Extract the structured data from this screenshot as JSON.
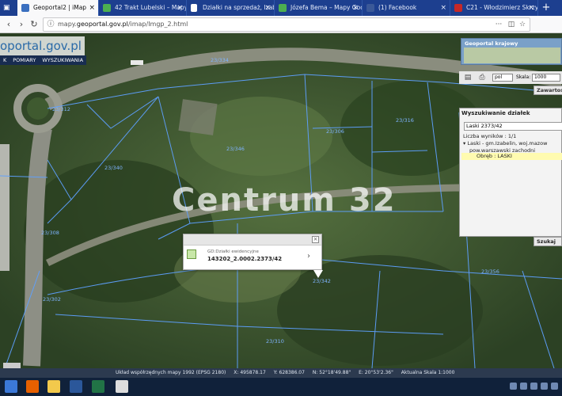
{
  "browser": {
    "tabs": [
      {
        "title": "Geoportal2 | iMap",
        "active": true,
        "icon_color": "#3a6fbf"
      },
      {
        "title": "42 Trakt Lubelski – Mapy Go",
        "active": false,
        "icon_color": "#4caf50"
      },
      {
        "title": "Działki na sprzedaż, Izabelin",
        "active": false,
        "icon_color": "#ffffff"
      },
      {
        "title": "Józefa Bema – Mapy Goo",
        "active": false,
        "icon_color": "#4caf50"
      },
      {
        "title": "(1) Facebook",
        "active": false,
        "icon_color": "#3b5998"
      },
      {
        "title": "C21 - Włodzimierz Skrzy",
        "active": false,
        "icon_color": "#c62828"
      }
    ],
    "close_glyph": "×",
    "new_tab_glyph": "+",
    "url_prefix": "mapy.",
    "url_domain": "geoportal.gov.pl",
    "url_path": "/imap/Imgp_2.html"
  },
  "app": {
    "logo_text": "oportal",
    "logo_domain": ".gov.pl",
    "menu": [
      "K",
      "POMIARY",
      "WYSZUKIWANIA"
    ]
  },
  "map": {
    "watermark": "Centrum 32",
    "parcel_labels": [
      "23/334",
      "23/346",
      "23/306",
      "23/316",
      "23/340",
      "23/312",
      "23/342",
      "23/356",
      "23/308",
      "23/302",
      "23/310"
    ]
  },
  "panel": {
    "geoportal_krajowy": "Geoportal krajowy",
    "lang": "pol",
    "skala_label": "Skala:",
    "skala_value": "1000",
    "zawartosc": "Zawartoś",
    "search_title": "Wyszukiwanie działek",
    "search_value": "Laski 2373/42",
    "results_count": "Liczba wyników : 1/1",
    "result_line1": "Laski - gm.Izabelin, woj.mazow",
    "result_line2": "pow.warszawski zachodni",
    "result_obreb": "Obręb : LASKI",
    "search_button": "Szukaj"
  },
  "popup": {
    "layer": "GD:Działki ewidencyjne",
    "parcel": "143202_2.0002.2373/42",
    "close_glyph": "×",
    "arrow_glyph": "›"
  },
  "status": {
    "crs": "Układ współrzędnych mapy 1992 (EPSG 2180)",
    "x": "X: 495878.17",
    "y": "Y: 628386.07",
    "n": "N: 52°18'49.88\"",
    "e": "E: 20°53'2.36\"",
    "scale": "Aktualna Skala 1:1000"
  },
  "colors": {
    "tabbar": "#1d3f8f",
    "parcel_lines": "#5ea0ff",
    "popup_bg": "#ffffff",
    "obreb_highlight": "#fffbb0"
  }
}
